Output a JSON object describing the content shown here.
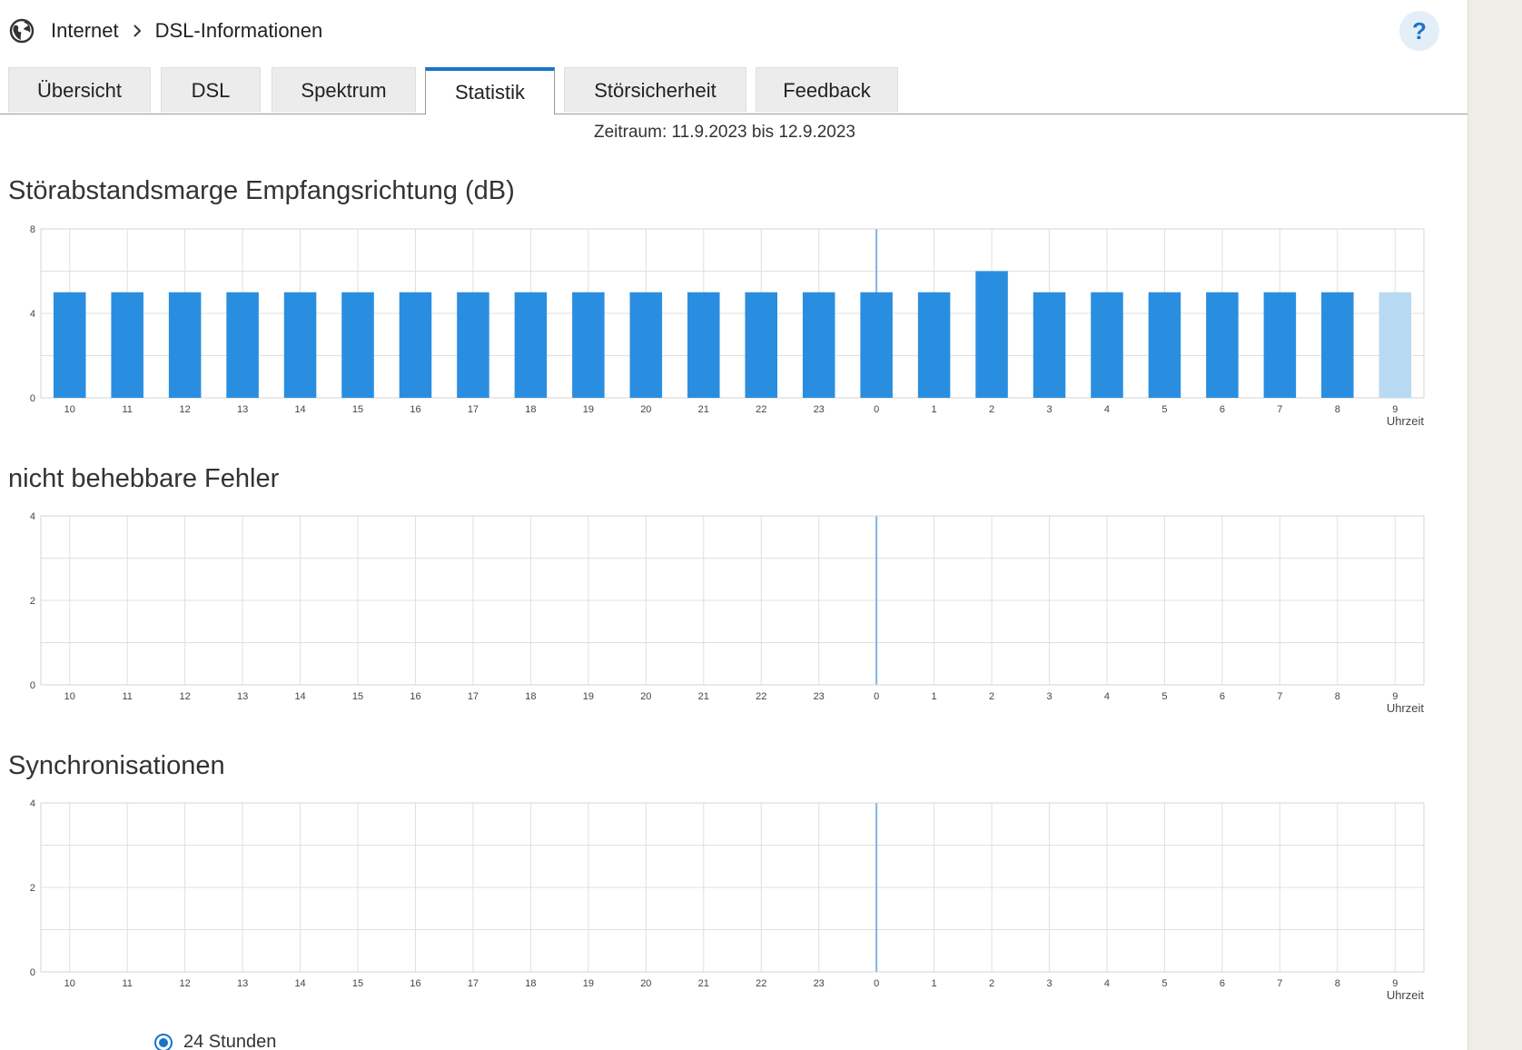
{
  "breadcrumb": {
    "icon": "globe-icon",
    "section": "Internet",
    "page": "DSL-Informationen",
    "separator_icon": "chevron-right-icon"
  },
  "help": {
    "label": "?"
  },
  "tabs": [
    {
      "label": "Übersicht",
      "active": false
    },
    {
      "label": "DSL",
      "active": false
    },
    {
      "label": "Spektrum",
      "active": false
    },
    {
      "label": "Statistik",
      "active": true
    },
    {
      "label": "Störsicherheit",
      "active": false
    },
    {
      "label": "Feedback",
      "active": false
    }
  ],
  "period": "Zeitraum: 11.9.2023 bis 12.9.2023",
  "colors": {
    "accent": "#1a73c8",
    "bar": "#2a8ee0",
    "bar_current": "#b8d9f2",
    "grid": "#e0e0e0",
    "midnight_line": "#7fb2e5"
  },
  "charts": [
    {
      "title": "Störabstandsmarge Empfangsrichtung (dB)"
    },
    {
      "title": "nicht behebbare Fehler"
    },
    {
      "title": "Synchronisationen"
    }
  ],
  "chart_data": [
    {
      "type": "bar",
      "title": "Störabstandsmarge Empfangsrichtung (dB)",
      "xlabel": "Uhrzeit",
      "ylabel": "",
      "categories": [
        "10",
        "11",
        "12",
        "13",
        "14",
        "15",
        "16",
        "17",
        "18",
        "19",
        "20",
        "21",
        "22",
        "23",
        "0",
        "1",
        "2",
        "3",
        "4",
        "5",
        "6",
        "7",
        "8",
        "9"
      ],
      "values": [
        5,
        5,
        5,
        5,
        5,
        5,
        5,
        5,
        5,
        5,
        5,
        5,
        5,
        5,
        5,
        5,
        6,
        5,
        5,
        5,
        5,
        5,
        5,
        5
      ],
      "current_index": 23,
      "yticks": [
        0,
        4,
        8
      ],
      "ylim": [
        0,
        8
      ],
      "grid": true,
      "midnight_category": "0"
    },
    {
      "type": "bar",
      "title": "nicht behebbare Fehler",
      "xlabel": "Uhrzeit",
      "ylabel": "",
      "categories": [
        "10",
        "11",
        "12",
        "13",
        "14",
        "15",
        "16",
        "17",
        "18",
        "19",
        "20",
        "21",
        "22",
        "23",
        "0",
        "1",
        "2",
        "3",
        "4",
        "5",
        "6",
        "7",
        "8",
        "9"
      ],
      "values": [
        0,
        0,
        0,
        0,
        0,
        0,
        0,
        0,
        0,
        0,
        0,
        0,
        0,
        0,
        0,
        0,
        0,
        0,
        0,
        0,
        0,
        0,
        0,
        0
      ],
      "yticks": [
        0,
        2,
        4
      ],
      "ylim": [
        0,
        4
      ],
      "grid": true,
      "midnight_category": "0"
    },
    {
      "type": "bar",
      "title": "Synchronisationen",
      "xlabel": "Uhrzeit",
      "ylabel": "",
      "categories": [
        "10",
        "11",
        "12",
        "13",
        "14",
        "15",
        "16",
        "17",
        "18",
        "19",
        "20",
        "21",
        "22",
        "23",
        "0",
        "1",
        "2",
        "3",
        "4",
        "5",
        "6",
        "7",
        "8",
        "9"
      ],
      "values": [
        0,
        0,
        0,
        0,
        0,
        0,
        0,
        0,
        0,
        0,
        0,
        0,
        0,
        0,
        0,
        0,
        0,
        0,
        0,
        0,
        0,
        0,
        0,
        0
      ],
      "yticks": [
        0,
        2,
        4
      ],
      "ylim": [
        0,
        4
      ],
      "grid": true,
      "midnight_category": "0"
    }
  ],
  "range_option": {
    "label": "24 Stunden",
    "selected": true
  }
}
